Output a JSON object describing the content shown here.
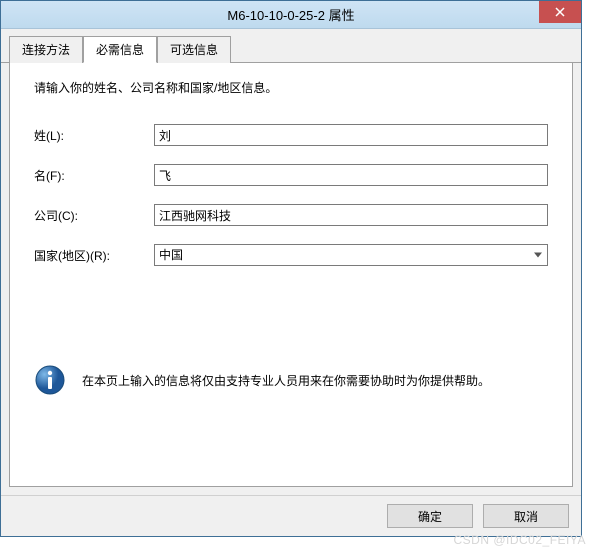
{
  "window": {
    "title": "M6-10-10-0-25-2 属性"
  },
  "tabs": {
    "tab1": "连接方法",
    "tab2": "必需信息",
    "tab3": "可选信息"
  },
  "form": {
    "instruction": "请输入你的姓名、公司名称和国家/地区信息。",
    "last_name_label": "姓(L):",
    "last_name_value": "刘",
    "first_name_label": "名(F):",
    "first_name_value": "飞",
    "company_label": "公司(C):",
    "company_value": "江西驰网科技",
    "country_label": "国家(地区)(R):",
    "country_value": "中国"
  },
  "info": {
    "text": "在本页上输入的信息将仅由支持专业人员用来在你需要协助时为你提供帮助。"
  },
  "buttons": {
    "ok": "确定",
    "cancel": "取消"
  },
  "watermark": "CSDN @IDC02_FEIYA"
}
